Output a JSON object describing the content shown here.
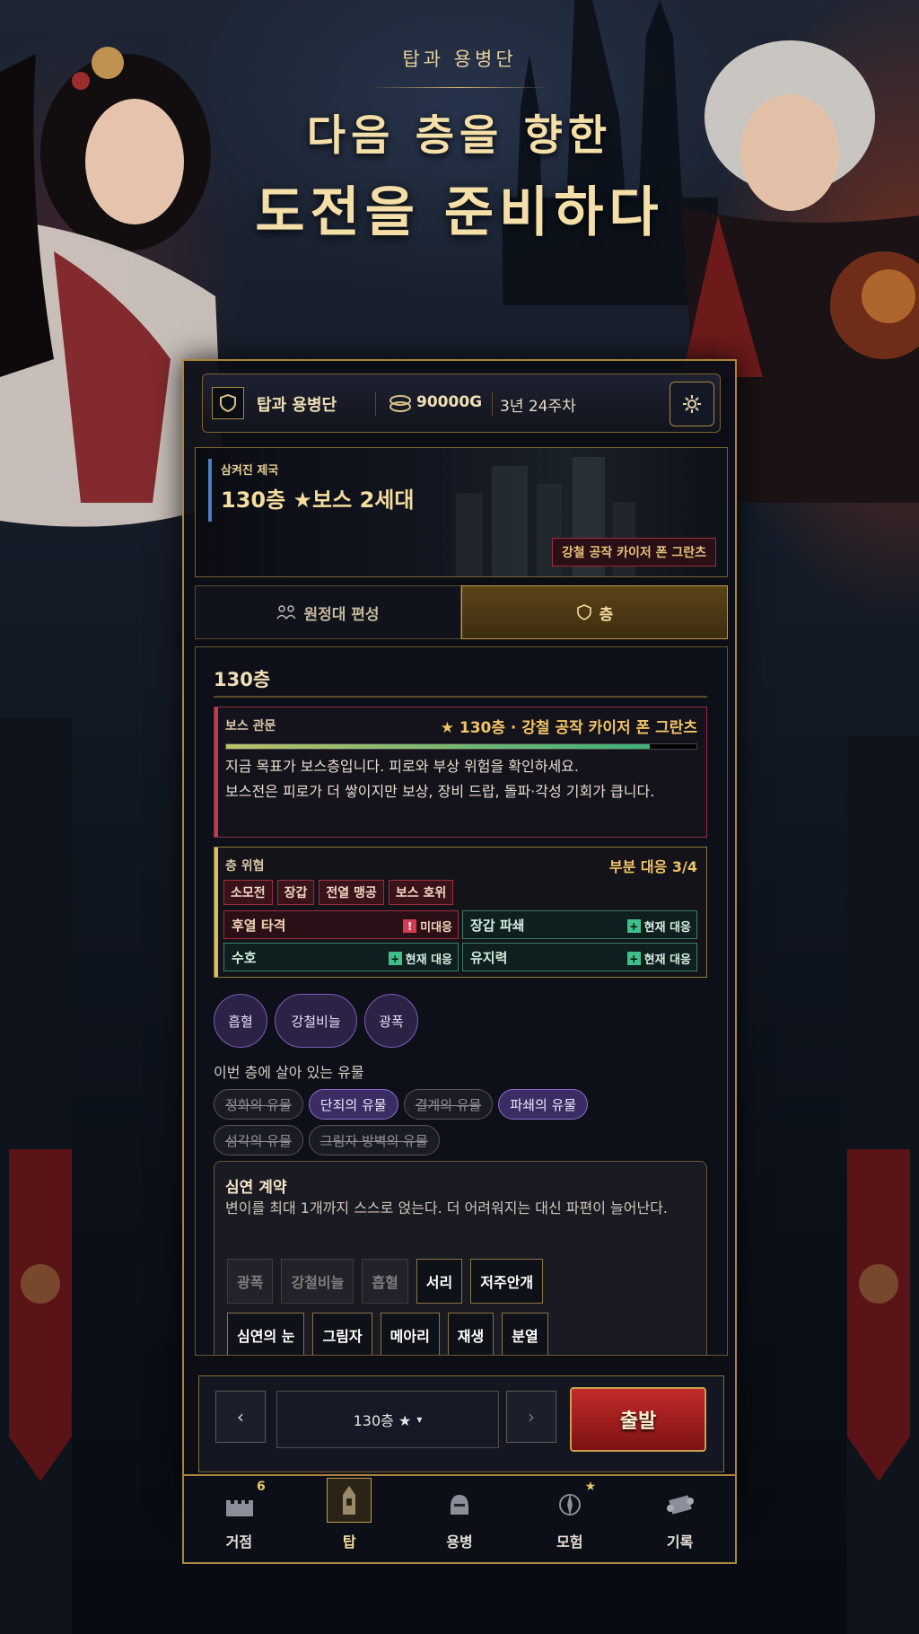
{
  "hero": {
    "subtitle": "탑과 용병단",
    "line1": "다음 층을 향한",
    "line2": "도전을 준비하다"
  },
  "topbar": {
    "title": "탑과 용병단",
    "gold": "90000G",
    "date": "3년 24주차",
    "icons": [
      "shield-icon",
      "coin-icon",
      "gear-icon"
    ]
  },
  "banner": {
    "label": "삼켜진 제국",
    "main": "130층 ★보스 2세대",
    "tag": "강철 공작 카이저 폰 그란츠"
  },
  "tabs": [
    {
      "label": "원정대 편성",
      "active": false
    },
    {
      "label": "층",
      "active": true
    }
  ],
  "floor": {
    "title": "130층",
    "boss": {
      "label": "보스 관문",
      "name": "★ 130층 · 강철 공작 카이저 폰 그란츠",
      "progress": 0.9,
      "line1": "지금 목표가 보스층입니다. 피로와 부상 위험을 확인하세요.",
      "line2": "보스전은 피로가 더 쌓이지만 보상, 장비 드랍, 돌파·각성 기회가 큽니다."
    },
    "hazard": {
      "label": "층 위협",
      "coverage": "부분 대응 3/4",
      "chips": [
        "소모전",
        "장갑",
        "전열 맹공",
        "보스 호위"
      ],
      "items": [
        {
          "name": "후열 타격",
          "status": "미대응",
          "ok": false
        },
        {
          "name": "장갑 파쇄",
          "status": "현재 대응",
          "ok": true
        },
        {
          "name": "수호",
          "status": "현재 대응",
          "ok": true
        },
        {
          "name": "유지력",
          "status": "현재 대응",
          "ok": true
        }
      ]
    },
    "traits": [
      "흡혈",
      "강철비늘",
      "광폭"
    ],
    "relic_title": "이번 층에 살아 있는 유물",
    "relics": [
      {
        "name": "정화의 유물",
        "active": false
      },
      {
        "name": "단죄의 유물",
        "active": true
      },
      {
        "name": "결계의 유물",
        "active": false
      },
      {
        "name": "파쇄의 유물",
        "active": true
      },
      {
        "name": "섬각의 유물",
        "active": false
      },
      {
        "name": "그림자 방벽의 유물",
        "active": false
      }
    ],
    "contract": {
      "title": "심연 계약",
      "desc": "변이를 최대 1개까지 스스로 얹는다. 더 어려워지는 대신 파편이 늘어난다.",
      "row1": [
        {
          "name": "광폭",
          "on": false
        },
        {
          "name": "강철비늘",
          "on": false
        },
        {
          "name": "흡혈",
          "on": false
        },
        {
          "name": "서리",
          "on": true
        },
        {
          "name": "저주안개",
          "on": true
        }
      ],
      "row2": [
        {
          "name": "심연의 눈",
          "on": true
        },
        {
          "name": "그림자",
          "on": true
        },
        {
          "name": "메아리",
          "on": true
        },
        {
          "name": "재생",
          "on": true
        },
        {
          "name": "분열",
          "on": true
        }
      ]
    }
  },
  "footer": {
    "prev": "‹",
    "next": "›",
    "selector": "130층 ★",
    "depart": "출발"
  },
  "nav": [
    {
      "label": "거점",
      "badge": "6",
      "active": false,
      "icon": "castle-icon"
    },
    {
      "label": "탑",
      "badge": "",
      "active": true,
      "icon": "tower-icon"
    },
    {
      "label": "용병",
      "badge": "",
      "active": false,
      "icon": "helmet-icon"
    },
    {
      "label": "모험",
      "badge": "★",
      "active": false,
      "icon": "compass-icon"
    },
    {
      "label": "기록",
      "badge": "",
      "active": false,
      "icon": "scroll-icon"
    }
  ],
  "colors": {
    "gold": "#a8853f",
    "accent": "#f5dca0",
    "danger": "#c13a4f",
    "ok": "#3fbf87",
    "relic_active": "#8a6ed0"
  }
}
